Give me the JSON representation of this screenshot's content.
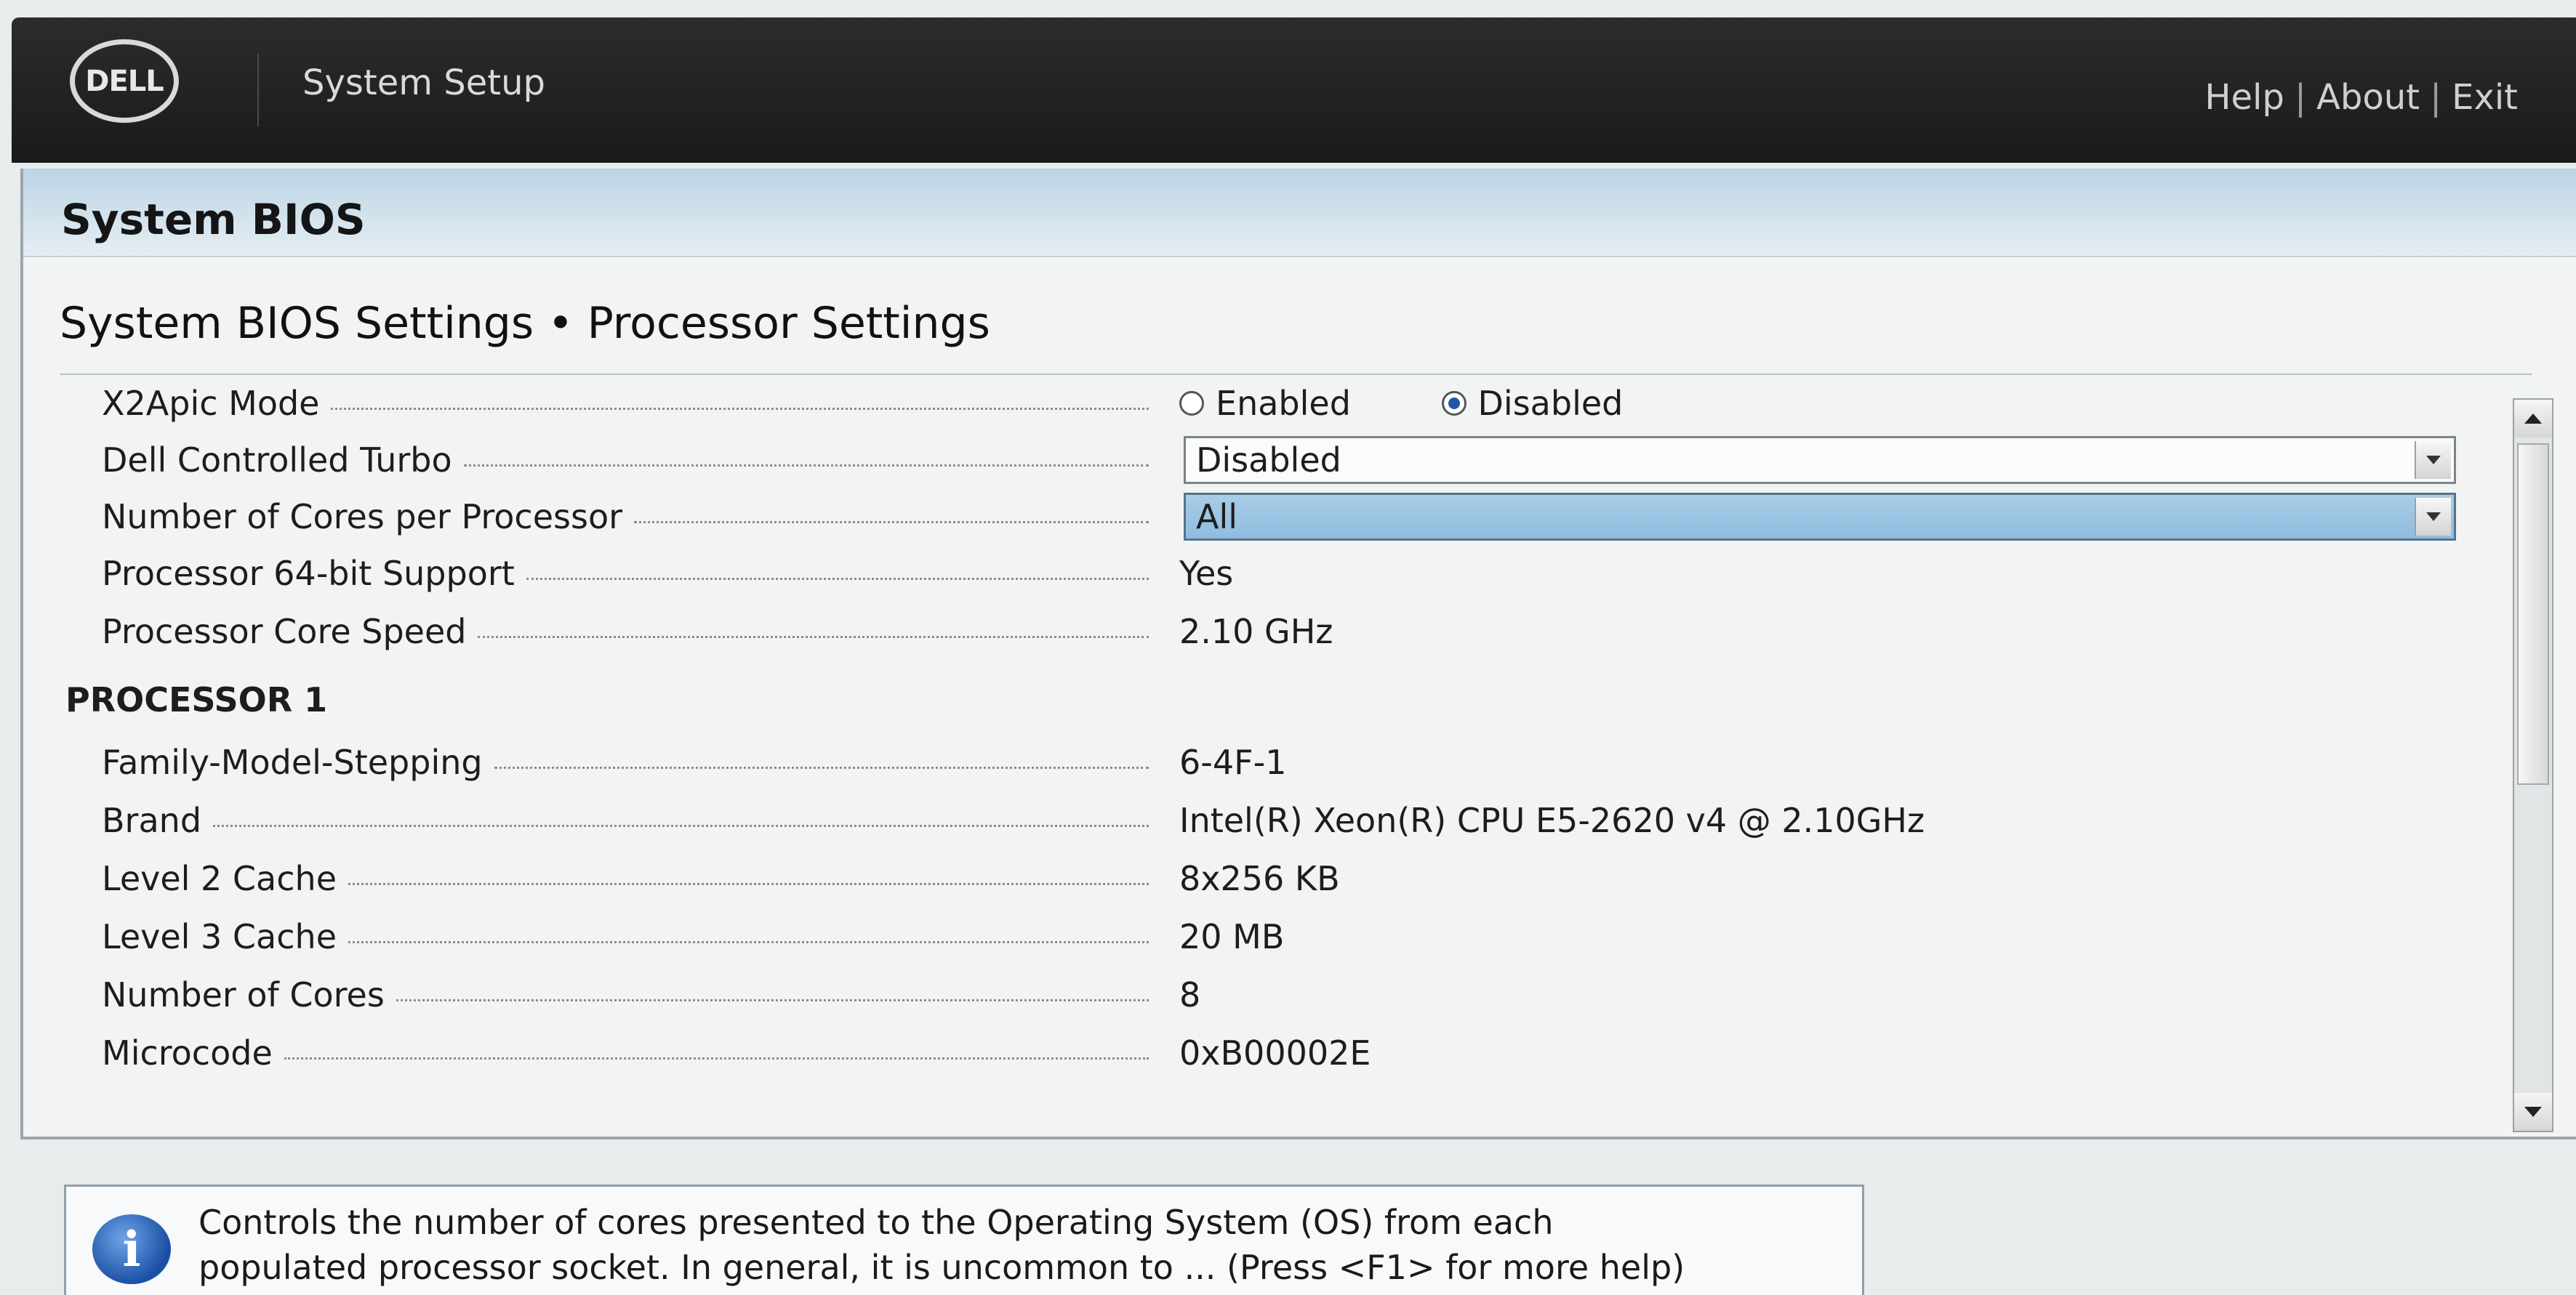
{
  "header": {
    "logo_text": "DELL",
    "app_title": "System Setup",
    "links": [
      "Help",
      "About",
      "Exit"
    ],
    "link_separator": "|"
  },
  "panel": {
    "title": "System BIOS",
    "breadcrumb": "System BIOS Settings • Processor Settings"
  },
  "settings": {
    "x2apic": {
      "label": "X2Apic Mode",
      "options": [
        "Enabled",
        "Disabled"
      ],
      "selected": "Disabled"
    },
    "turbo": {
      "label": "Dell Controlled Turbo",
      "value": "Disabled"
    },
    "cores_per_proc": {
      "label": "Number of Cores per Processor",
      "value": "All"
    },
    "bit64": {
      "label": "Processor 64-bit Support",
      "value": "Yes"
    },
    "core_speed": {
      "label": "Processor Core Speed",
      "value": "2.10 GHz"
    }
  },
  "processor1": {
    "heading": "PROCESSOR 1",
    "rows": [
      {
        "label": "Family-Model-Stepping",
        "value": "6-4F-1"
      },
      {
        "label": "Brand",
        "value": "Intel(R) Xeon(R) CPU E5-2620 v4 @ 2.10GHz"
      },
      {
        "label": "Level 2 Cache",
        "value": "8x256 KB"
      },
      {
        "label": "Level 3 Cache",
        "value": "20 MB"
      },
      {
        "label": "Number of Cores",
        "value": "8"
      },
      {
        "label": "Microcode",
        "value": "0xB00002E"
      }
    ]
  },
  "help": {
    "icon": "info-icon",
    "line1": "Controls the number of cores presented to the Operating System (OS) from each",
    "line2": "populated processor socket. In general, it is uncommon to ... (Press <F1> for more help)"
  },
  "colors": {
    "header_bg": "#1f1f20",
    "panel_head": "#c9dbe8",
    "focus_select": "#9cc6e4",
    "radio_selected": "#1f56a8"
  }
}
